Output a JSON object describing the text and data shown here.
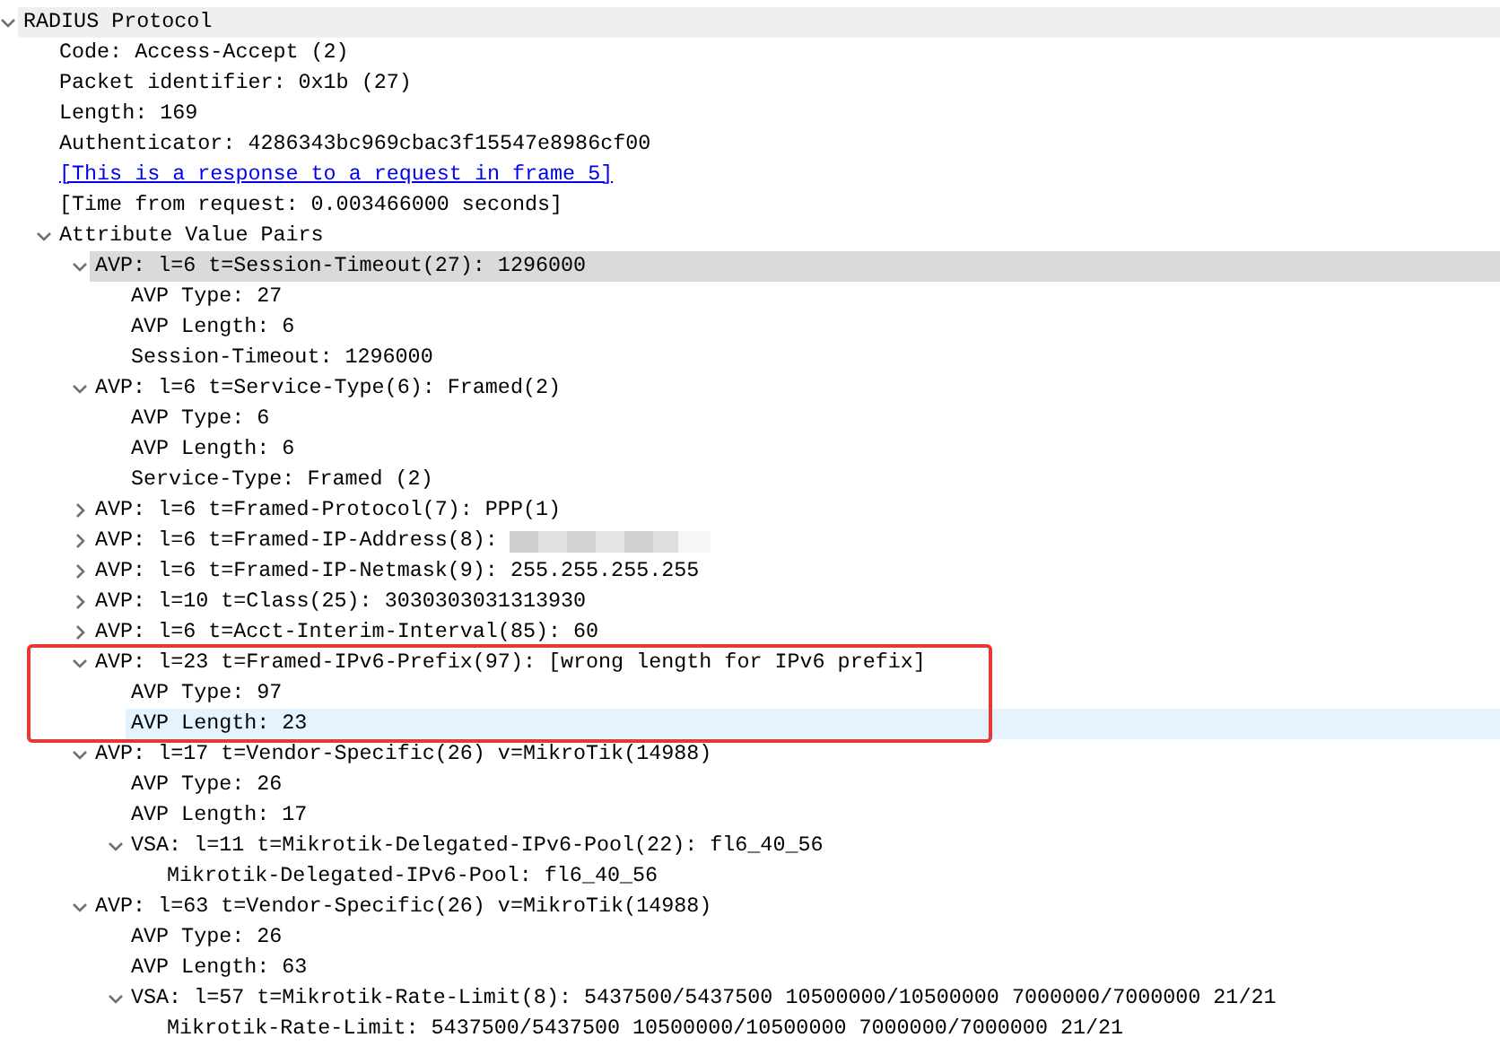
{
  "tree": [
    {
      "text": "RADIUS Protocol",
      "expanded": true,
      "selected": false,
      "shaded": true,
      "hovered": false,
      "children": [
        {
          "text": "Code: Access-Accept (2)",
          "selected": false,
          "shaded": false,
          "hovered": false
        },
        {
          "text": "Packet identifier: 0x1b (27)",
          "selected": false,
          "shaded": false,
          "hovered": false
        },
        {
          "text": "Length: 169",
          "selected": false,
          "shaded": false,
          "hovered": false
        },
        {
          "text": "Authenticator: 4286343bc969cbac3f15547e8986cf00",
          "selected": false,
          "shaded": false,
          "hovered": false
        },
        {
          "text": "[This is a response to a request in frame 5]",
          "kind": "link",
          "selected": false,
          "shaded": false,
          "hovered": false
        },
        {
          "text": "[Time from request: 0.003466000 seconds]",
          "selected": false,
          "shaded": false,
          "hovered": false
        },
        {
          "text": "Attribute Value Pairs",
          "expanded": true,
          "selected": false,
          "shaded": false,
          "hovered": false,
          "children": [
            {
              "text": "AVP: l=6 t=Session-Timeout(27): 1296000",
              "expanded": true,
              "selected": true,
              "shaded": false,
              "hovered": false,
              "children": [
                {
                  "text": "AVP Type: 27",
                  "selected": false,
                  "shaded": false,
                  "hovered": false
                },
                {
                  "text": "AVP Length: 6",
                  "selected": false,
                  "shaded": false,
                  "hovered": false
                },
                {
                  "text": "Session-Timeout: 1296000",
                  "selected": false,
                  "shaded": false,
                  "hovered": false
                }
              ]
            },
            {
              "text": "AVP: l=6 t=Service-Type(6): Framed(2)",
              "expanded": true,
              "selected": false,
              "shaded": false,
              "hovered": false,
              "children": [
                {
                  "text": "AVP Type: 6",
                  "selected": false,
                  "shaded": false,
                  "hovered": false
                },
                {
                  "text": "AVP Length: 6",
                  "selected": false,
                  "shaded": false,
                  "hovered": false
                },
                {
                  "text": "Service-Type: Framed (2)",
                  "selected": false,
                  "shaded": false,
                  "hovered": false
                }
              ]
            },
            {
              "text": "AVP: l=6 t=Framed-Protocol(7): PPP(1)",
              "expanded": false,
              "selected": false,
              "shaded": false,
              "hovered": false
            },
            {
              "text": "AVP: l=6 t=Framed-IP-Address(8):",
              "expanded": false,
              "redacted": true,
              "selected": false,
              "shaded": false,
              "hovered": false
            },
            {
              "text": "AVP: l=6 t=Framed-IP-Netmask(9): 255.255.255.255",
              "expanded": false,
              "selected": false,
              "shaded": false,
              "hovered": false
            },
            {
              "text": "AVP: l=10 t=Class(25): 3030303031313930",
              "expanded": false,
              "selected": false,
              "shaded": false,
              "hovered": false
            },
            {
              "text": "AVP: l=6 t=Acct-Interim-Interval(85): 60",
              "expanded": false,
              "selected": false,
              "shaded": false,
              "hovered": false
            },
            {
              "text": "AVP: l=23 t=Framed-IPv6-Prefix(97): [wrong length for IPv6 prefix]",
              "expanded": true,
              "boxed": true,
              "selected": false,
              "shaded": false,
              "hovered": false,
              "children": [
                {
                  "text": "AVP Type: 97",
                  "selected": false,
                  "shaded": false,
                  "hovered": false
                },
                {
                  "text": "AVP Length: 23",
                  "selected": false,
                  "shaded": false,
                  "hovered": true
                }
              ]
            },
            {
              "text": "AVP: l=17 t=Vendor-Specific(26) v=MikroTik(14988)",
              "expanded": true,
              "selected": false,
              "shaded": false,
              "hovered": false,
              "children": [
                {
                  "text": "AVP Type: 26",
                  "selected": false,
                  "shaded": false,
                  "hovered": false
                },
                {
                  "text": "AVP Length: 17",
                  "selected": false,
                  "shaded": false,
                  "hovered": false
                },
                {
                  "text": "VSA: l=11 t=Mikrotik-Delegated-IPv6-Pool(22): fl6_40_56",
                  "expanded": true,
                  "selected": false,
                  "shaded": false,
                  "hovered": false,
                  "children": [
                    {
                      "text": "Mikrotik-Delegated-IPv6-Pool: fl6_40_56",
                      "selected": false,
                      "shaded": false,
                      "hovered": false
                    }
                  ]
                }
              ]
            },
            {
              "text": "AVP: l=63 t=Vendor-Specific(26) v=MikroTik(14988)",
              "expanded": true,
              "selected": false,
              "shaded": false,
              "hovered": false,
              "children": [
                {
                  "text": "AVP Type: 26",
                  "selected": false,
                  "shaded": false,
                  "hovered": false
                },
                {
                  "text": "AVP Length: 63",
                  "selected": false,
                  "shaded": false,
                  "hovered": false
                },
                {
                  "text": "VSA: l=57 t=Mikrotik-Rate-Limit(8): 5437500/5437500 10500000/10500000 7000000/7000000 21/21",
                  "expanded": true,
                  "selected": false,
                  "shaded": false,
                  "hovered": false,
                  "children": [
                    {
                      "text": "Mikrotik-Rate-Limit: 5437500/5437500 10500000/10500000 7000000/7000000 21/21",
                      "selected": false,
                      "shaded": false,
                      "hovered": false
                    }
                  ]
                }
              ]
            }
          ]
        }
      ]
    }
  ]
}
